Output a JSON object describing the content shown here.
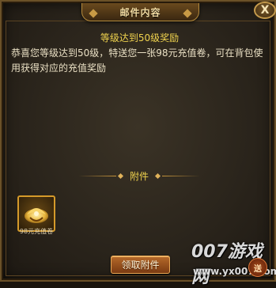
{
  "window": {
    "title": "邮件内容",
    "close_label": "X"
  },
  "mail": {
    "subject": "等级达到50级奖励",
    "body": "恭喜您等级达到50级，特送您一张98元充值卷，可在背包使用获得对应的充值奖励"
  },
  "attachments": {
    "header": "附件",
    "items": [
      {
        "label": "98元充值卷",
        "icon": "recharge-coupon-icon"
      }
    ]
  },
  "actions": {
    "claim_label": "领取附件"
  },
  "watermark": {
    "brand": "007游戏网",
    "url": "www.yx007.com",
    "badge": "送"
  },
  "colors": {
    "accent_gold": "#f0d34e",
    "body_text": "#eae0c4",
    "button": "#9a5020"
  }
}
